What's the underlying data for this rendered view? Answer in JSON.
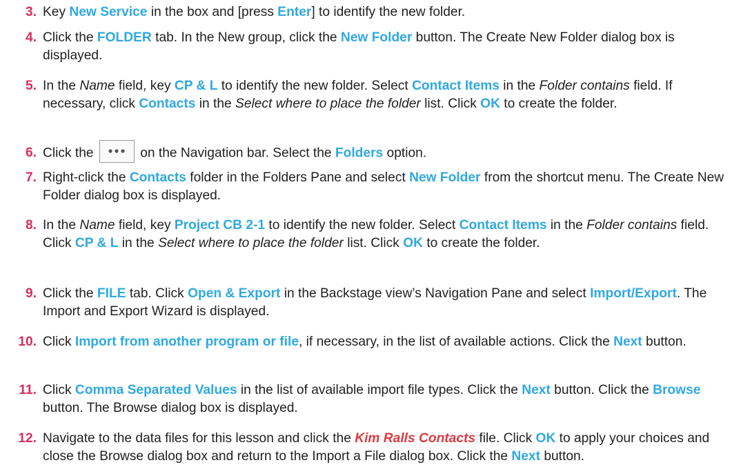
{
  "steps": [
    {
      "number": "3.",
      "parts": [
        {
          "t": "Key "
        },
        {
          "t": "New Service",
          "s": "hl"
        },
        {
          "t": " in the box and [press "
        },
        {
          "t": "Enter",
          "s": "hl"
        },
        {
          "t": "] to identify the new folder."
        }
      ]
    },
    {
      "number": "4.",
      "parts": [
        {
          "t": "Click the "
        },
        {
          "t": "FOLDER",
          "s": "hl"
        },
        {
          "t": " tab. In the New group, click the "
        },
        {
          "t": "New Folder",
          "s": "hl"
        },
        {
          "t": " button. The Create New Folder dialog box is displayed."
        }
      ]
    },
    {
      "number": "5.",
      "parts": [
        {
          "t": "In the "
        },
        {
          "t": "Name",
          "s": "it"
        },
        {
          "t": " field, key "
        },
        {
          "t": "CP & L",
          "s": "hl"
        },
        {
          "t": " to identify the new folder. Select "
        },
        {
          "t": "Contact Items",
          "s": "hl"
        },
        {
          "t": " in the "
        },
        {
          "t": "Folder contains",
          "s": "it"
        },
        {
          "t": " field. If necessary, click "
        },
        {
          "t": "Contacts",
          "s": "hl"
        },
        {
          "t": " in the "
        },
        {
          "t": "Select where to place the folder",
          "s": "it"
        },
        {
          "t": " list. Click "
        },
        {
          "t": "OK",
          "s": "hl"
        },
        {
          "t": " to create the folder."
        }
      ]
    },
    {
      "number": "6.",
      "parts": [
        {
          "t": "Click the "
        },
        {
          "btn": "more-icon"
        },
        {
          "t": " on the Navigation bar. Select the "
        },
        {
          "t": "Folders",
          "s": "hl"
        },
        {
          "t": " option."
        }
      ]
    },
    {
      "number": "7.",
      "parts": [
        {
          "t": "Right-click the "
        },
        {
          "t": "Contacts",
          "s": "hl"
        },
        {
          "t": " folder in the Folders Pane and select "
        },
        {
          "t": "New Folder",
          "s": "hl"
        },
        {
          "t": " from the shortcut menu. The Create New Folder dialog box is displayed."
        }
      ]
    },
    {
      "number": "8.",
      "parts": [
        {
          "t": "In the "
        },
        {
          "t": "Name",
          "s": "it"
        },
        {
          "t": " field, key "
        },
        {
          "t": "Project CB 2-1",
          "s": "hl"
        },
        {
          "t": " to identify the new folder. Select "
        },
        {
          "t": "Contact Items",
          "s": "hl"
        },
        {
          "t": " in the "
        },
        {
          "t": "Folder contains",
          "s": "it"
        },
        {
          "t": " field. Click "
        },
        {
          "t": "CP & L",
          "s": "hl"
        },
        {
          "t": " in the "
        },
        {
          "t": "Select where to place the folder",
          "s": "it"
        },
        {
          "t": " list. Click "
        },
        {
          "t": "OK",
          "s": "hl"
        },
        {
          "t": " to create the folder."
        }
      ]
    },
    {
      "number": "9.",
      "parts": [
        {
          "t": "Click the "
        },
        {
          "t": "FILE",
          "s": "hl"
        },
        {
          "t": " tab. Click "
        },
        {
          "t": "Open & Export",
          "s": "hl"
        },
        {
          "t": " in the Backstage view’s Navigation Pane and select "
        },
        {
          "t": "Import/Export",
          "s": "hl"
        },
        {
          "t": ". The Import and Export Wizard is displayed."
        }
      ]
    },
    {
      "number": "10.",
      "parts": [
        {
          "t": "Click "
        },
        {
          "t": "Import from another program or file",
          "s": "hl"
        },
        {
          "t": ", if necessary, in the list of available actions. Click the "
        },
        {
          "t": "Next",
          "s": "hl"
        },
        {
          "t": " button."
        }
      ]
    },
    {
      "number": "11.",
      "parts": [
        {
          "t": "Click "
        },
        {
          "t": "Comma Separated Values",
          "s": "hl"
        },
        {
          "t": " in the list of available import file types. Click the "
        },
        {
          "t": "Next",
          "s": "hl"
        },
        {
          "t": " button. Click the "
        },
        {
          "t": "Browse",
          "s": "hl"
        },
        {
          "t": " button. The Browse dialog box is displayed."
        }
      ]
    },
    {
      "number": "12.",
      "parts": [
        {
          "t": "Navigate to the data files for this lesson and click the "
        },
        {
          "t": "Kim Ralls Contacts",
          "s": "file"
        },
        {
          "t": " file. Click "
        },
        {
          "t": "OK",
          "s": "hl"
        },
        {
          "t": " to apply your choices and close the Browse dialog box and return to the Import a File dialog box. Click the "
        },
        {
          "t": "Next",
          "s": "hl"
        },
        {
          "t": " button."
        }
      ]
    }
  ],
  "colors": {
    "step_number": "#d5305f",
    "highlight": "#2fa9e0",
    "file_name": "#e03a3e",
    "text": "#1f1f1f"
  }
}
